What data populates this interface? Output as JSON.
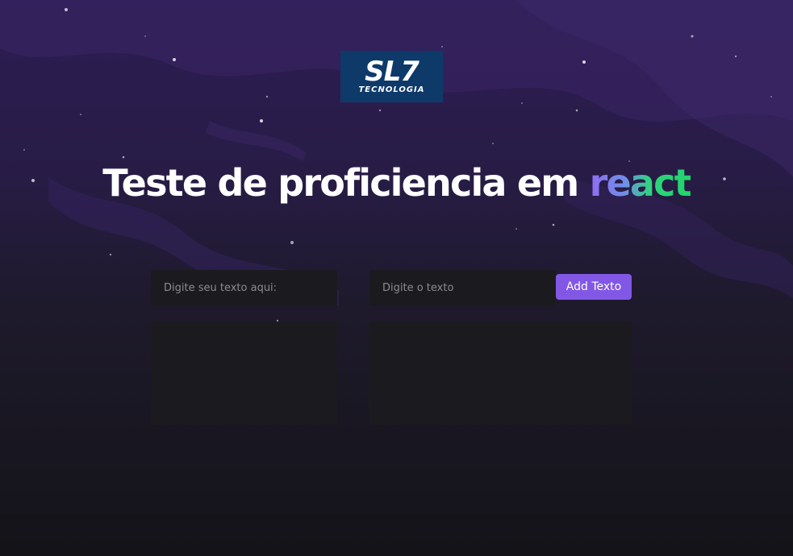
{
  "logo": {
    "main": "SL7",
    "sub": "TECNOLOGIA"
  },
  "header": {
    "title_prefix": "Teste de proficiencia em ",
    "title_accent": "react"
  },
  "form": {
    "left_input": {
      "placeholder": "Digite seu texto aqui:",
      "value": ""
    },
    "right_input": {
      "placeholder": "Digite o texto",
      "value": ""
    },
    "add_button_label": "Add Texto"
  },
  "colors": {
    "background_top": "#2c1d52",
    "background_bottom": "#141318",
    "field_bg": "#1b1b1f",
    "button_bg": "#8257e6",
    "accent_start": "#8f6cf3",
    "accent_end": "#22d46c",
    "logo_bg": "#0e3a6a"
  }
}
